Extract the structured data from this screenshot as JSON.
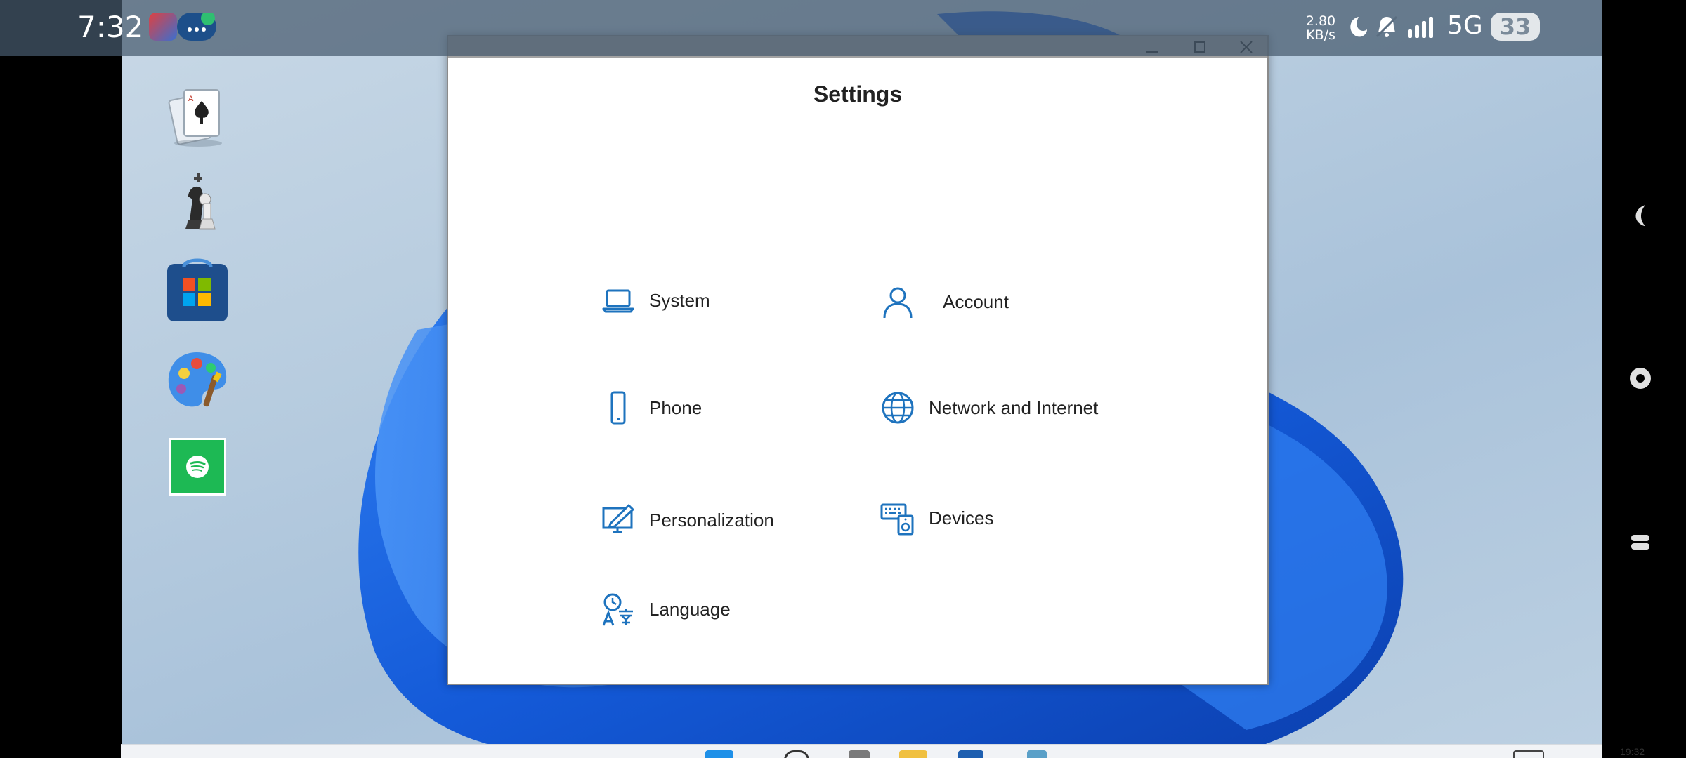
{
  "status_bar": {
    "time": "7:32",
    "net_speed_value": "2.80",
    "net_speed_unit": "KB/s",
    "network_type": "5G",
    "battery_level": "33",
    "icons": [
      "app-notification-icon",
      "edge-icon",
      "more-icon",
      "moon-icon",
      "mute-bell-icon",
      "signal-icon"
    ]
  },
  "desktop": {
    "shortcuts": [
      "solitaire-icon",
      "chess-icon",
      "microsoft-store-icon",
      "paint-icon",
      "spotify-icon"
    ]
  },
  "window": {
    "title": "Settings",
    "controls": [
      "minimize-icon",
      "maximize-icon",
      "close-icon"
    ],
    "items": [
      {
        "label": "System",
        "icon": "laptop-icon"
      },
      {
        "label": "Account",
        "icon": "person-icon"
      },
      {
        "label": "Phone",
        "icon": "phone-icon"
      },
      {
        "label": "Network and Internet",
        "icon": "globe-icon"
      },
      {
        "label": "Personalization",
        "icon": "pen-monitor-icon"
      },
      {
        "label": "Devices",
        "icon": "devices-icon"
      },
      {
        "label": "Language",
        "icon": "language-icon"
      }
    ]
  },
  "taskbar": {
    "clock": "19:32",
    "icons": [
      "start-icon",
      "search-icon",
      "chess-icon",
      "file-explorer-icon",
      "store-icon",
      "app-icon"
    ]
  },
  "colors": {
    "accent": "#1e73be",
    "titlebar": "#a3a3a3",
    "wallpaper_bloom": "#1a5fd6"
  }
}
